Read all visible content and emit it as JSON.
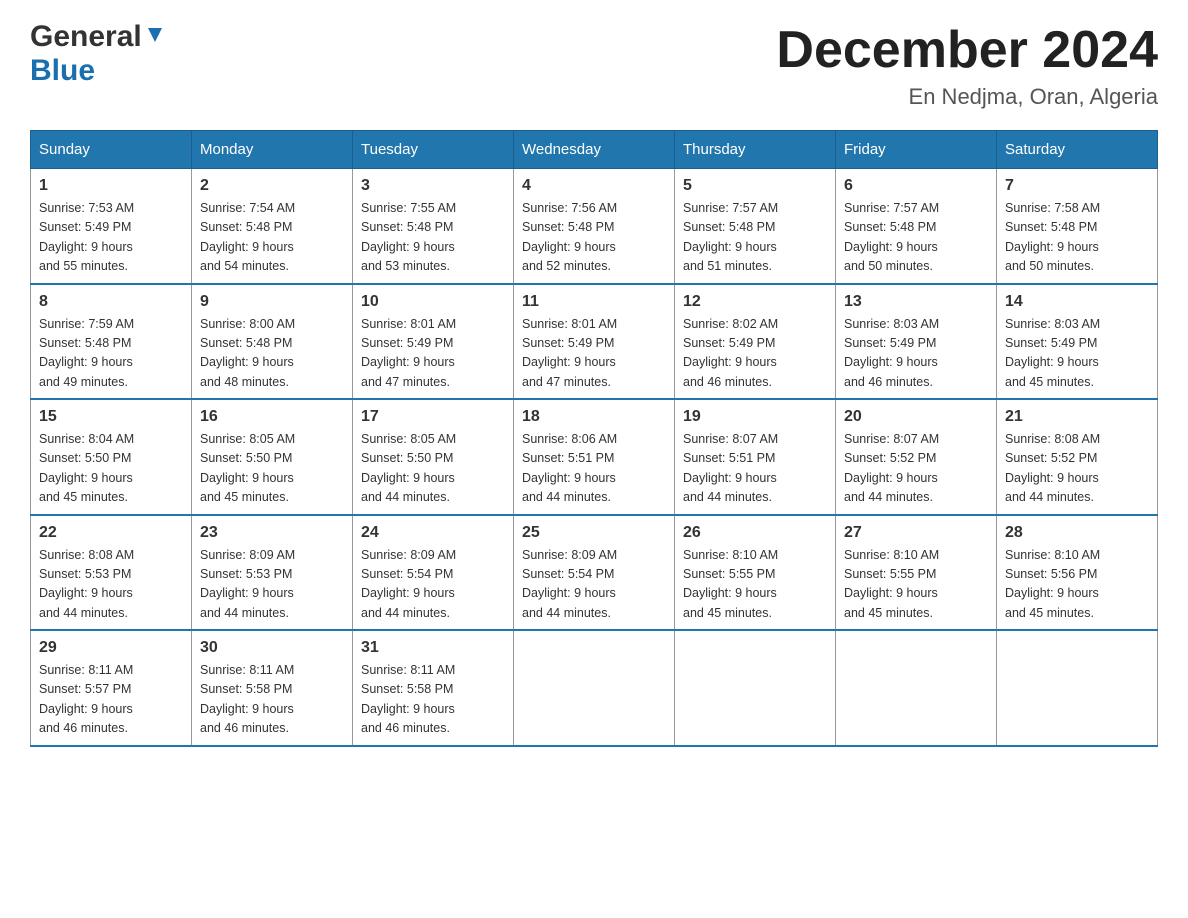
{
  "header": {
    "logo": {
      "line1": "General",
      "line2": "Blue"
    },
    "title": "December 2024",
    "subtitle": "En Nedjma, Oran, Algeria"
  },
  "weekdays": [
    "Sunday",
    "Monday",
    "Tuesday",
    "Wednesday",
    "Thursday",
    "Friday",
    "Saturday"
  ],
  "weeks": [
    [
      {
        "day": "1",
        "sunrise": "7:53 AM",
        "sunset": "5:49 PM",
        "daylight": "9 hours and 55 minutes."
      },
      {
        "day": "2",
        "sunrise": "7:54 AM",
        "sunset": "5:48 PM",
        "daylight": "9 hours and 54 minutes."
      },
      {
        "day": "3",
        "sunrise": "7:55 AM",
        "sunset": "5:48 PM",
        "daylight": "9 hours and 53 minutes."
      },
      {
        "day": "4",
        "sunrise": "7:56 AM",
        "sunset": "5:48 PM",
        "daylight": "9 hours and 52 minutes."
      },
      {
        "day": "5",
        "sunrise": "7:57 AM",
        "sunset": "5:48 PM",
        "daylight": "9 hours and 51 minutes."
      },
      {
        "day": "6",
        "sunrise": "7:57 AM",
        "sunset": "5:48 PM",
        "daylight": "9 hours and 50 minutes."
      },
      {
        "day": "7",
        "sunrise": "7:58 AM",
        "sunset": "5:48 PM",
        "daylight": "9 hours and 50 minutes."
      }
    ],
    [
      {
        "day": "8",
        "sunrise": "7:59 AM",
        "sunset": "5:48 PM",
        "daylight": "9 hours and 49 minutes."
      },
      {
        "day": "9",
        "sunrise": "8:00 AM",
        "sunset": "5:48 PM",
        "daylight": "9 hours and 48 minutes."
      },
      {
        "day": "10",
        "sunrise": "8:01 AM",
        "sunset": "5:49 PM",
        "daylight": "9 hours and 47 minutes."
      },
      {
        "day": "11",
        "sunrise": "8:01 AM",
        "sunset": "5:49 PM",
        "daylight": "9 hours and 47 minutes."
      },
      {
        "day": "12",
        "sunrise": "8:02 AM",
        "sunset": "5:49 PM",
        "daylight": "9 hours and 46 minutes."
      },
      {
        "day": "13",
        "sunrise": "8:03 AM",
        "sunset": "5:49 PM",
        "daylight": "9 hours and 46 minutes."
      },
      {
        "day": "14",
        "sunrise": "8:03 AM",
        "sunset": "5:49 PM",
        "daylight": "9 hours and 45 minutes."
      }
    ],
    [
      {
        "day": "15",
        "sunrise": "8:04 AM",
        "sunset": "5:50 PM",
        "daylight": "9 hours and 45 minutes."
      },
      {
        "day": "16",
        "sunrise": "8:05 AM",
        "sunset": "5:50 PM",
        "daylight": "9 hours and 45 minutes."
      },
      {
        "day": "17",
        "sunrise": "8:05 AM",
        "sunset": "5:50 PM",
        "daylight": "9 hours and 44 minutes."
      },
      {
        "day": "18",
        "sunrise": "8:06 AM",
        "sunset": "5:51 PM",
        "daylight": "9 hours and 44 minutes."
      },
      {
        "day": "19",
        "sunrise": "8:07 AM",
        "sunset": "5:51 PM",
        "daylight": "9 hours and 44 minutes."
      },
      {
        "day": "20",
        "sunrise": "8:07 AM",
        "sunset": "5:52 PM",
        "daylight": "9 hours and 44 minutes."
      },
      {
        "day": "21",
        "sunrise": "8:08 AM",
        "sunset": "5:52 PM",
        "daylight": "9 hours and 44 minutes."
      }
    ],
    [
      {
        "day": "22",
        "sunrise": "8:08 AM",
        "sunset": "5:53 PM",
        "daylight": "9 hours and 44 minutes."
      },
      {
        "day": "23",
        "sunrise": "8:09 AM",
        "sunset": "5:53 PM",
        "daylight": "9 hours and 44 minutes."
      },
      {
        "day": "24",
        "sunrise": "8:09 AM",
        "sunset": "5:54 PM",
        "daylight": "9 hours and 44 minutes."
      },
      {
        "day": "25",
        "sunrise": "8:09 AM",
        "sunset": "5:54 PM",
        "daylight": "9 hours and 44 minutes."
      },
      {
        "day": "26",
        "sunrise": "8:10 AM",
        "sunset": "5:55 PM",
        "daylight": "9 hours and 45 minutes."
      },
      {
        "day": "27",
        "sunrise": "8:10 AM",
        "sunset": "5:55 PM",
        "daylight": "9 hours and 45 minutes."
      },
      {
        "day": "28",
        "sunrise": "8:10 AM",
        "sunset": "5:56 PM",
        "daylight": "9 hours and 45 minutes."
      }
    ],
    [
      {
        "day": "29",
        "sunrise": "8:11 AM",
        "sunset": "5:57 PM",
        "daylight": "9 hours and 46 minutes."
      },
      {
        "day": "30",
        "sunrise": "8:11 AM",
        "sunset": "5:58 PM",
        "daylight": "9 hours and 46 minutes."
      },
      {
        "day": "31",
        "sunrise": "8:11 AM",
        "sunset": "5:58 PM",
        "daylight": "9 hours and 46 minutes."
      },
      null,
      null,
      null,
      null
    ]
  ],
  "labels": {
    "sunrise": "Sunrise:",
    "sunset": "Sunset:",
    "daylight": "Daylight:"
  }
}
